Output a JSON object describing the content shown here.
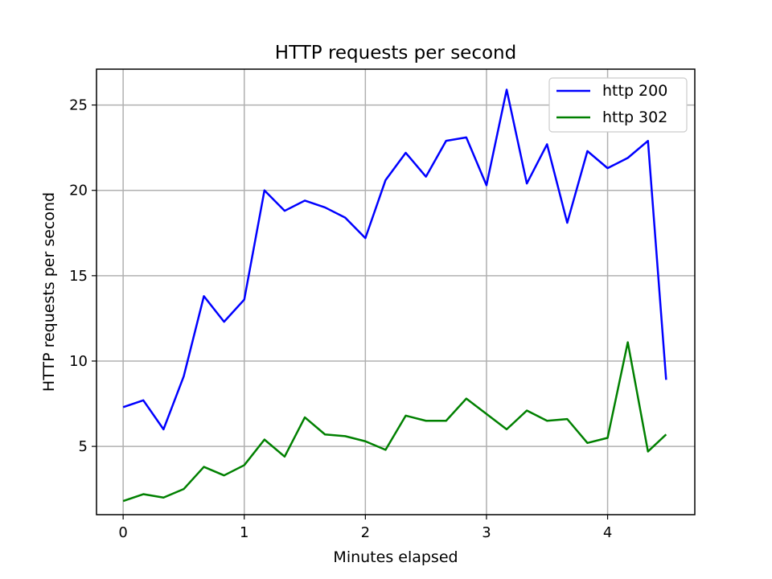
{
  "chart_data": {
    "type": "line",
    "title": "HTTP requests per second",
    "xlabel": "Minutes elapsed",
    "ylabel": "HTTP requests per second",
    "xlim": [
      -0.22,
      4.72
    ],
    "ylim": [
      1.0,
      27.1
    ],
    "xticks": [
      0,
      1,
      2,
      3,
      4
    ],
    "yticks": [
      5,
      10,
      15,
      20,
      25
    ],
    "grid": true,
    "legend_position": "top-right",
    "x": [
      0,
      0.1667,
      0.3333,
      0.5,
      0.6667,
      0.8333,
      1.0,
      1.1667,
      1.3333,
      1.5,
      1.6667,
      1.8333,
      2.0,
      2.1667,
      2.3333,
      2.5,
      2.6667,
      2.8333,
      3.0,
      3.1667,
      3.3333,
      3.5,
      3.6667,
      3.8333,
      4.0,
      4.1667,
      4.3333,
      4.4833
    ],
    "series": [
      {
        "name": "http 200",
        "color": "#0000ff",
        "values": [
          7.3,
          7.7,
          6.0,
          9.1,
          13.8,
          12.3,
          13.6,
          20.0,
          18.8,
          19.4,
          19.0,
          18.4,
          17.2,
          20.6,
          22.2,
          20.8,
          22.9,
          23.1,
          20.3,
          25.9,
          20.4,
          22.7,
          18.1,
          22.3,
          21.3,
          21.9,
          22.9,
          8.9
        ]
      },
      {
        "name": "http 302",
        "color": "#008000",
        "values": [
          1.8,
          2.2,
          2.0,
          2.5,
          3.8,
          3.3,
          3.9,
          5.4,
          4.4,
          6.7,
          5.7,
          5.6,
          5.3,
          4.8,
          6.8,
          6.5,
          6.5,
          7.8,
          6.9,
          6.0,
          7.1,
          6.5,
          6.6,
          5.2,
          5.5,
          11.1,
          4.7,
          5.7
        ]
      }
    ]
  }
}
